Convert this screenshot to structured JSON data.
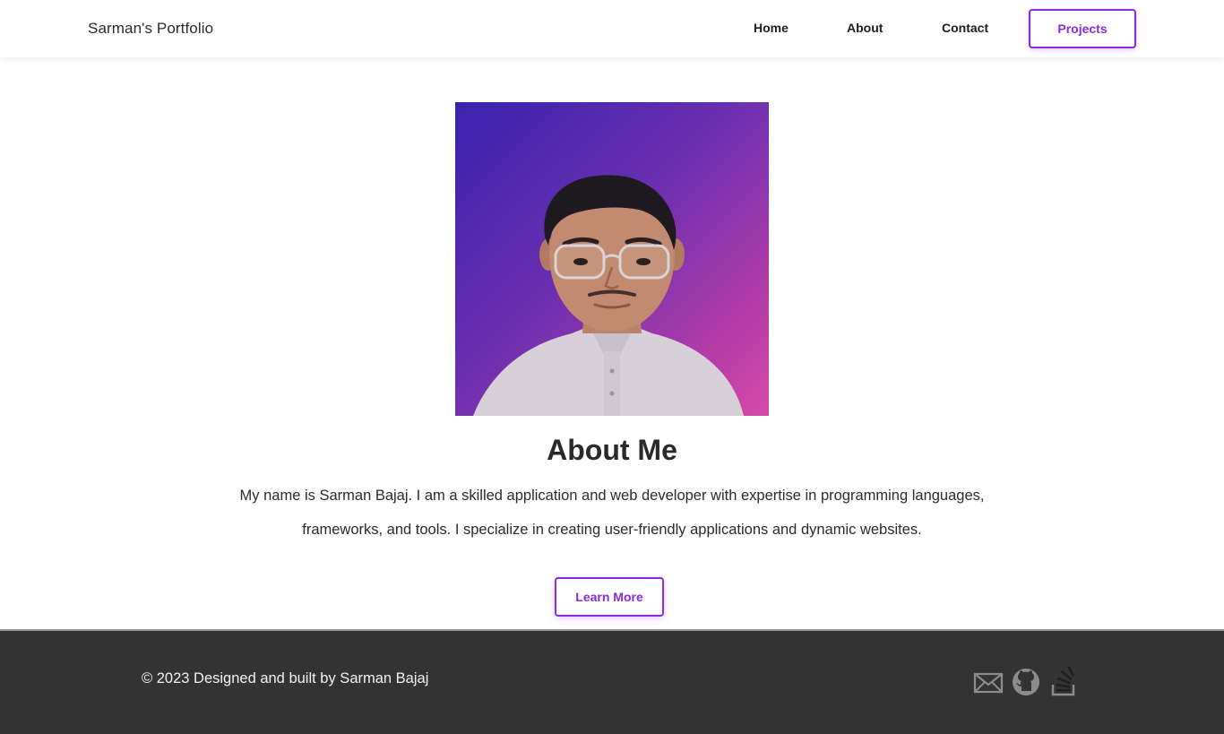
{
  "header": {
    "brand": "Sarman's Portfolio",
    "nav": {
      "home": "Home",
      "about": "About",
      "contact": "Contact",
      "projects": "Projects"
    }
  },
  "about": {
    "title": "About Me",
    "paragraph": "My name is Sarman Bajaj. I am a skilled application and web developer with expertise in programming languages, frameworks, and tools. I specialize in creating user-friendly applications and dynamic websites.",
    "button": "Learn More"
  },
  "footer": {
    "copyright": "© 2023 Designed and built by Sarman Bajaj",
    "social_icons": [
      "mail-icon",
      "github-icon",
      "stackoverflow-icon"
    ]
  },
  "colors": {
    "accent": "#8a2be2",
    "footer_bg": "#333333",
    "portrait_gradient_start": "#3a22ad",
    "portrait_gradient_end": "#d64aa8"
  }
}
